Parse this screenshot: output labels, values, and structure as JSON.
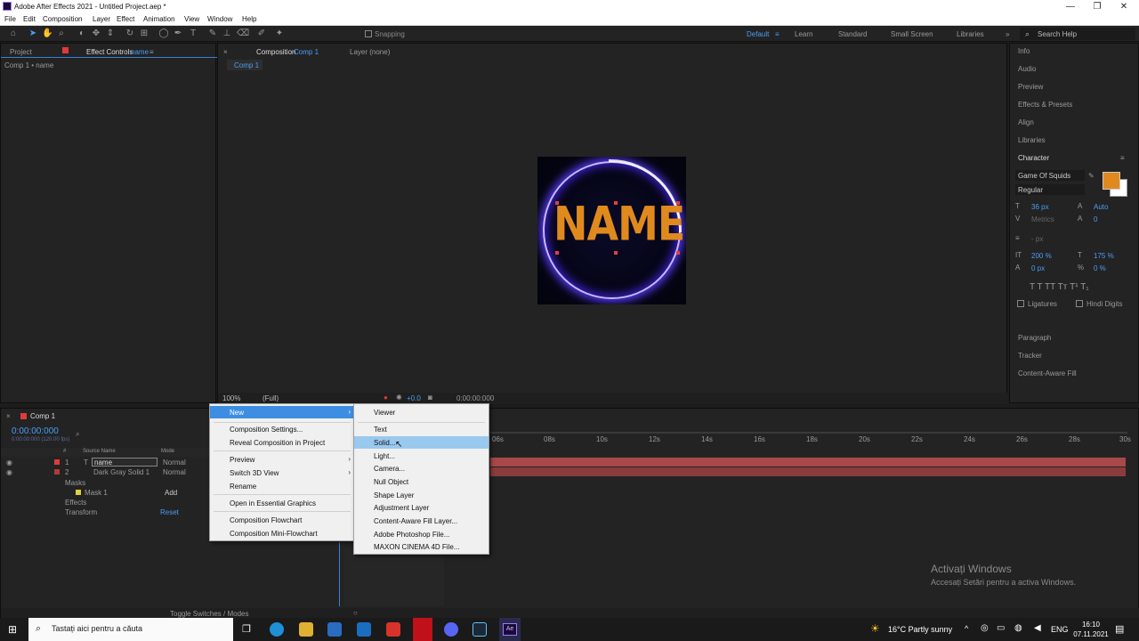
{
  "window": {
    "title": "Adobe After Effects 2021 - Untitled Project.aep *",
    "minimize": "—",
    "restore": "❐",
    "close": "✕"
  },
  "menubar": [
    "File",
    "Edit",
    "Composition",
    "Layer",
    "Effect",
    "Animation",
    "View",
    "Window",
    "Help"
  ],
  "toolbar": {
    "snapping_label": "Snapping",
    "workspaces": [
      "Default",
      "Learn",
      "Standard",
      "Small Screen",
      "Libraries"
    ],
    "search_placeholder": "Search Help"
  },
  "left_panel": {
    "tab_project": "Project",
    "tab_effect_controls": "Effect Controls",
    "effect_controls_target": "name",
    "breadcrumb": "Comp 1 • name"
  },
  "viewer": {
    "tab_composition": "Composition",
    "composition_name": "Comp 1",
    "tab_layer": "Layer (none)",
    "active_comp_tab": "Comp 1",
    "canvas_text": "NAME",
    "zoom": "100%",
    "resolution": "(Full)",
    "exposure": "+0.0",
    "timecode": "0:00:00:000"
  },
  "right_panel": {
    "items": [
      "Info",
      "Audio",
      "Preview",
      "Effects & Presets",
      "Align",
      "Libraries",
      "Character"
    ],
    "character": {
      "font": "Game Of Squids",
      "style": "Regular",
      "size": "36 px",
      "leading": "Auto",
      "kerning": "Metrics",
      "tracking": "0",
      "stroke": "- px",
      "vscale": "200 %",
      "hscale": "175 %",
      "baseline": "0 px",
      "tsume": "0 %",
      "fill_color": "#e08a1e",
      "ligatures": "Ligatures",
      "hindi_digits": "Hindi Digits"
    },
    "lower_items": [
      "Paragraph",
      "Tracker",
      "Content-Aware Fill"
    ]
  },
  "timeline": {
    "comp_tab": "Comp 1",
    "timecode": "0:00:00:000",
    "fps": "0:00:00:000 (120.00 fps)",
    "columns": {
      "number": "#",
      "source": "Source Name",
      "mode": "Mode"
    },
    "layers": [
      {
        "num": "1",
        "type": "T",
        "name": "name",
        "mode": "Normal"
      },
      {
        "num": "2",
        "type": "",
        "name": "Dark Gray Solid 1",
        "mode": "Normal"
      }
    ],
    "masks_label": "Masks",
    "mask1": "Mask 1",
    "mask_mode": "Add",
    "effects_label": "Effects",
    "transform_label": "Transform",
    "reset_label": "Reset",
    "ruler": [
      "06s",
      "08s",
      "10s",
      "12s",
      "14s",
      "16s",
      "18s",
      "20s",
      "22s",
      "24s",
      "26s",
      "28s",
      "30s"
    ],
    "toggle_label": "Toggle Switches / Modes"
  },
  "context_menu": {
    "items": [
      {
        "label": "New",
        "submenu": true
      },
      {
        "label": "Composition Settings..."
      },
      {
        "label": "Reveal Composition in Project"
      },
      {
        "label": "Preview",
        "submenu": true
      },
      {
        "label": "Switch 3D View",
        "submenu": true
      },
      {
        "label": "Rename"
      },
      {
        "label": "Open in Essential Graphics"
      },
      {
        "label": "Composition Flowchart"
      },
      {
        "label": "Composition Mini-Flowchart"
      }
    ],
    "submenu_new": [
      "Viewer",
      "Text",
      "Solid...",
      "Light...",
      "Camera...",
      "Null Object",
      "Shape Layer",
      "Adjustment Layer",
      "Content-Aware Fill Layer...",
      "Adobe Photoshop File...",
      "MAXON CINEMA 4D File..."
    ]
  },
  "watermark": {
    "line1": "Activați Windows",
    "line2": "Accesați Setări pentru a activa Windows."
  },
  "taskbar": {
    "search_placeholder": "Tastați aici pentru a căuta",
    "weather": "16°C  Partly sunny",
    "lang": "ENG",
    "time": "16:10",
    "date": "07.11.2021"
  }
}
